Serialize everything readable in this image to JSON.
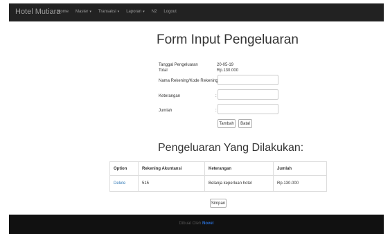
{
  "navbar": {
    "brand": "Hotel Mutiara",
    "items": [
      {
        "label": "Home",
        "has_dropdown": false
      },
      {
        "label": "Master",
        "has_dropdown": true
      },
      {
        "label": "Transaksi",
        "has_dropdown": true
      },
      {
        "label": "Laporan",
        "has_dropdown": true
      },
      {
        "label": "N2",
        "has_dropdown": false
      },
      {
        "label": "Logout",
        "has_dropdown": false
      }
    ],
    "caret": "▾"
  },
  "form": {
    "title": "Form Input Pengeluaran",
    "tanggal_label": "Tanggal Pengeluaran",
    "tanggal_value": "20-05-19",
    "total_label": "Total",
    "total_value": "Rp.130.000",
    "rekening_label": "Nama Rekening/Kode Rekening",
    "keterangan_label": "Keterangan",
    "jumlah_label": "Jumlah",
    "colon": ":",
    "rekening_value": "",
    "keterangan_value": "",
    "jumlah_value": "",
    "tambah_label": "Tambah",
    "batal_label": "Batal"
  },
  "table": {
    "title": "Pengeluaran Yang Dilakukan:",
    "headers": [
      "Option",
      "Rekening Akuntansi",
      "Keterangan",
      "Jumlah"
    ],
    "rows": [
      {
        "option": "Delete",
        "rekening": "515",
        "keterangan": "Belanja keperluan hotel",
        "jumlah": "Rp.130.000"
      }
    ],
    "simpan_label": "Simpan"
  },
  "footer": {
    "prefix": "Dibuat Oleh",
    "author": "Novel"
  },
  "colors": {
    "navbar_bg": "#222222",
    "footer_bg": "#111111",
    "link": "#337ab7"
  }
}
